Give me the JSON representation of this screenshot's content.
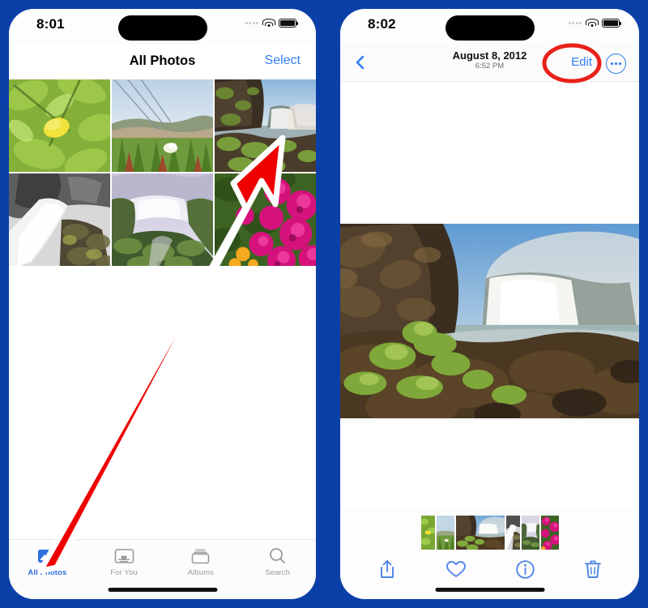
{
  "annotation": {
    "arrow_color": "#ef0000",
    "arrow_outline": "#ffffff",
    "highlight_color": "#e8211a",
    "arrow_target": "all-photos-tab",
    "highlight_target": "edit-button"
  },
  "theme": {
    "frame_blue": "#0b3fa8",
    "ios_blue": "#2f7ef5",
    "tab_active_blue": "#2f6ee0",
    "tab_inactive_gray": "#9a9a9a"
  },
  "left_phone": {
    "status": {
      "time": "8:01"
    },
    "nav": {
      "title": "All Photos",
      "select_label": "Select"
    },
    "grid": {
      "photos": [
        {
          "alt": "lemon-tree",
          "kind": "lemon"
        },
        {
          "alt": "coastal-succulents",
          "kind": "succulents"
        },
        {
          "alt": "waterfall-cliff-moss",
          "kind": "waterfall-cliff"
        },
        {
          "alt": "waterfall-black-white",
          "kind": "waterfall-bw"
        },
        {
          "alt": "wide-waterfall-canyon",
          "kind": "waterfall-canyon"
        },
        {
          "alt": "pink-flowers",
          "kind": "pink-flowers"
        }
      ]
    },
    "tabs": [
      {
        "label": "All Photos",
        "icon": "photos-icon",
        "active": true
      },
      {
        "label": "For You",
        "icon": "for-you-icon",
        "active": false
      },
      {
        "label": "Albums",
        "icon": "albums-icon",
        "active": false
      },
      {
        "label": "Search",
        "icon": "search-icon",
        "active": false
      }
    ]
  },
  "right_phone": {
    "status": {
      "time": "8:02"
    },
    "nav": {
      "back_icon": "chevron-left-icon",
      "date": "August 8, 2012",
      "time": "6:52 PM",
      "edit_label": "Edit",
      "more_icon": "ellipsis-icon"
    },
    "photo": {
      "alt": "waterfall-cliff-moss-large",
      "kind": "waterfall-cliff"
    },
    "filmstrip": [
      {
        "alt": "lemon-tree",
        "kind": "lemon",
        "size": "sm"
      },
      {
        "alt": "coastal-succulents",
        "kind": "succulents",
        "size": "md"
      },
      {
        "alt": "waterfall-cliff-moss",
        "kind": "waterfall-cliff",
        "size": "sel",
        "selected": true
      },
      {
        "alt": "waterfall-black-white",
        "kind": "waterfall-bw",
        "size": "sm"
      },
      {
        "alt": "wide-waterfall-canyon",
        "kind": "waterfall-canyon",
        "size": "md"
      },
      {
        "alt": "pink-flowers",
        "kind": "pink-flowers",
        "size": "md"
      }
    ],
    "tools": [
      {
        "name": "share-icon",
        "label": "Share"
      },
      {
        "name": "heart-icon",
        "label": "Favorite"
      },
      {
        "name": "info-icon",
        "label": "Info"
      },
      {
        "name": "trash-icon",
        "label": "Delete"
      }
    ]
  }
}
